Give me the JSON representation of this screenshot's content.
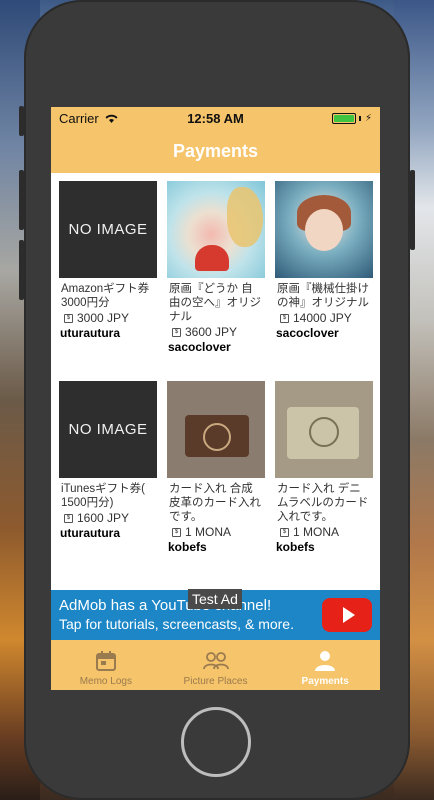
{
  "status_bar": {
    "carrier": "Carrier",
    "time": "12:58 AM"
  },
  "nav": {
    "title": "Payments"
  },
  "items": [
    {
      "image": "NO IMAGE",
      "title_line1": "Amazonギフト券",
      "title_line2": "3000円分",
      "title_line3": "",
      "price": "3000 JPY",
      "seller": "uturautura"
    },
    {
      "image": "",
      "title_line1": "原画『どうか 自",
      "title_line2": "由の空へ』オリジ",
      "title_line3": "ナル",
      "price": "3600 JPY",
      "seller": "sacoclover"
    },
    {
      "image": "",
      "title_line1": "原画『機械仕掛け",
      "title_line2": "の神』オリジナル",
      "title_line3": "",
      "price": "14000 JPY",
      "seller": "sacoclover"
    },
    {
      "image": "NO IMAGE",
      "title_line1": "iTunesギフト券(",
      "title_line2": "1500円分)",
      "title_line3": "",
      "price": "1600 JPY",
      "seller": "uturautura"
    },
    {
      "image": "",
      "title_line1": "カード入れ 合成",
      "title_line2": "皮革のカード入れ",
      "title_line3": "です。",
      "price": "1 MONA",
      "seller": "kobefs"
    },
    {
      "image": "",
      "title_line1": "カード入れ デニ",
      "title_line2": "ムラベルのカード",
      "title_line3": "入れです。",
      "price": "1 MONA",
      "seller": "kobefs"
    }
  ],
  "ad": {
    "line1": "AdMob has a YouTube channel!",
    "line2": "Tap for tutorials, screencasts, & more.",
    "test_label": "Test Ad"
  },
  "tabs": [
    {
      "label": "Memo Logs",
      "icon": "calendar-icon"
    },
    {
      "label": "Picture Places",
      "icon": "people-icon"
    },
    {
      "label": "Payments",
      "icon": "person-icon"
    }
  ],
  "colors": {
    "accent": "#f6c46a",
    "ad_blue": "#1c86c7",
    "battery": "#3ec43e"
  }
}
